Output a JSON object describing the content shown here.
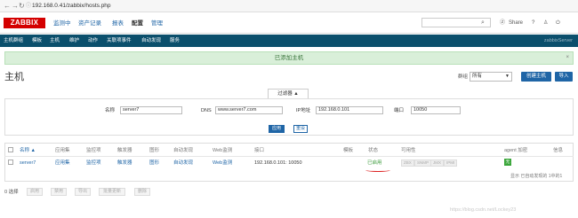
{
  "browser": {
    "url": "192.168.0.41/zabbix/hosts.php"
  },
  "header": {
    "logo": "ZABBIX",
    "menu": [
      "监测中",
      "资产记录",
      "报表",
      "配置",
      "管理"
    ],
    "share": "Share",
    "help": "?"
  },
  "submenu": {
    "items": [
      "主机群组",
      "模板",
      "主机",
      "维护",
      "动作",
      "关联项事件",
      "自动发现",
      "服务"
    ],
    "server": "zabbixServer"
  },
  "message": {
    "text": "已添加主机",
    "close": "×"
  },
  "page": {
    "title": "主机",
    "group_label": "群组",
    "group_value": "所有",
    "create_button": "创建主机",
    "import_button": "导入"
  },
  "filter": {
    "tab": "过滤器 ▲",
    "name_label": "名称",
    "name_value": "server7",
    "dns_label": "DNS",
    "dns_value": "www.server7.com",
    "ip_label": "IP地址",
    "ip_value": "192.168.0.101",
    "port_label": "端口",
    "port_value": "10050",
    "apply": "应用",
    "reset": "重设"
  },
  "table": {
    "headers": [
      "名称 ▲",
      "应用集",
      "监控项",
      "触发器",
      "图形",
      "自动发现",
      "Web监测",
      "接口",
      "模板",
      "状态",
      "可用性",
      "agent 加密",
      "信息"
    ],
    "row": {
      "name": "server7",
      "apps": "应用集",
      "items": "监控项",
      "triggers": "触发器",
      "graphs": "图形",
      "discovery": "自动发现",
      "web": "Web监测",
      "interface": "192.168.0.101: 10050",
      "status": "已启用",
      "availability": [
        "ZBX",
        "SNMP",
        "JMX",
        "IPMI"
      ],
      "encryption": "无"
    },
    "count": "显示 已自动发现的 1中的1"
  },
  "footer": {
    "selected": "0 选择",
    "buttons": [
      "启用",
      "禁用",
      "导出",
      "批量更新",
      "删除"
    ]
  },
  "watermark": "https://blog.csdn.net/Lockey23"
}
